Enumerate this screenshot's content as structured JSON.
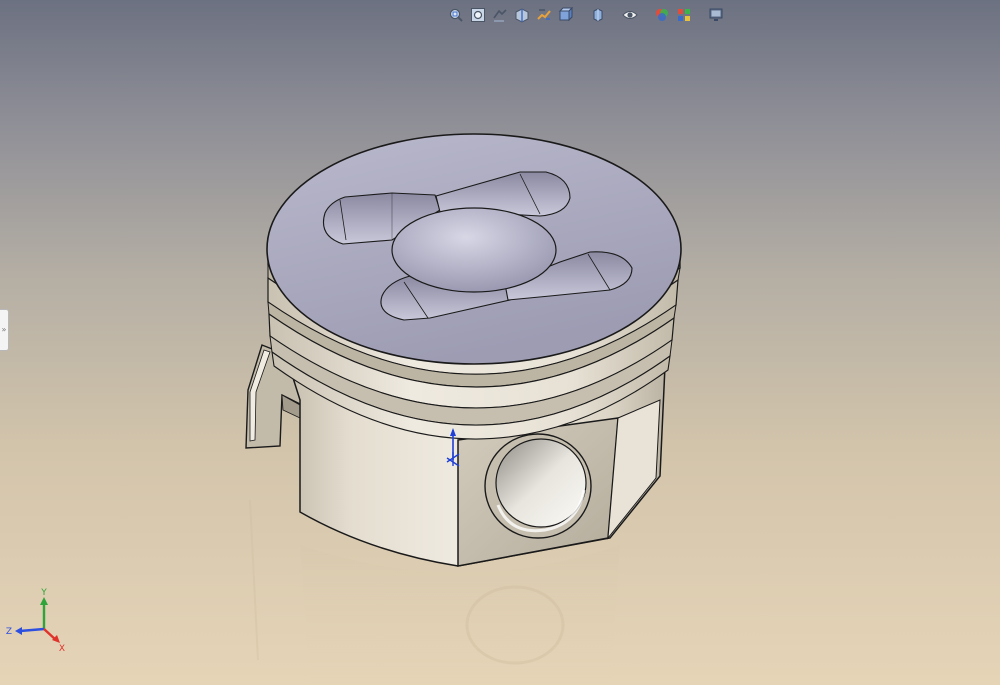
{
  "toolbar": {
    "items": [
      {
        "id": "zoom-to-fit",
        "icon": "zoom-to-fit-icon"
      },
      {
        "id": "zoom-to-area",
        "icon": "zoom-to-area-icon"
      },
      {
        "id": "previous-view",
        "icon": "previous-view-icon"
      },
      {
        "id": "section-view",
        "icon": "section-view-icon"
      },
      {
        "id": "dynamic-annotation-views",
        "icon": "dynamic-annotation-icon"
      },
      {
        "id": "view-orientation",
        "icon": "view-orientation-icon"
      },
      {
        "id": "display-style",
        "icon": "display-style-icon"
      },
      {
        "id": "hide-show-items",
        "icon": "hide-show-icon"
      },
      {
        "id": "edit-appearance",
        "icon": "edit-appearance-icon"
      },
      {
        "id": "apply-scene",
        "icon": "apply-scene-icon"
      },
      {
        "id": "view-settings",
        "icon": "view-settings-icon"
      }
    ]
  },
  "triad": {
    "x_label": "X",
    "y_label": "Y",
    "z_label": "Z",
    "x_color": "#e0332c",
    "y_color": "#2fa43a",
    "z_color": "#2d4fe0"
  },
  "side_tab": {
    "glyph": "»"
  },
  "colors": {
    "background_top": "#6c7181",
    "background_bottom": "#e6d4b7",
    "part_face": "#ece7dc",
    "crown_face": "#a9a8be",
    "edge": "#1a1a1a",
    "origin_marker": "#1e3fd8"
  }
}
